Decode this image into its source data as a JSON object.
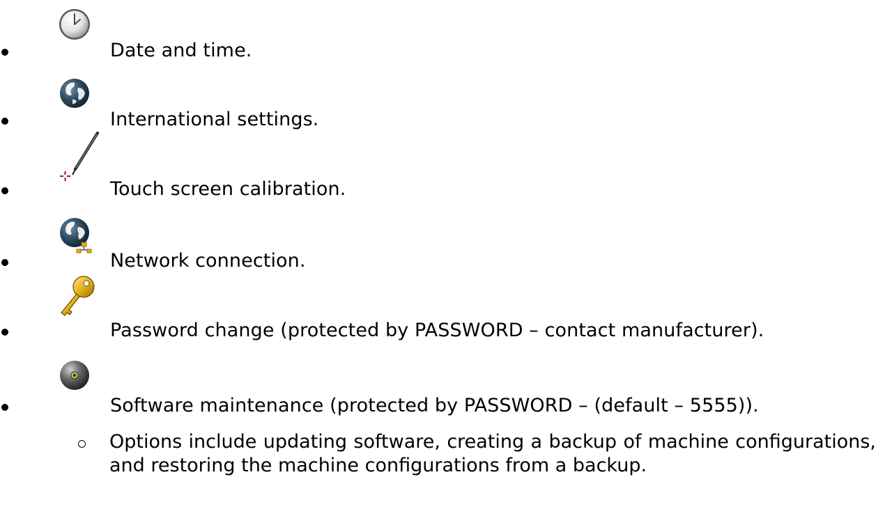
{
  "items": [
    {
      "icon": "clock-icon",
      "label": "Date and time."
    },
    {
      "icon": "globe-icon",
      "label": "International settings."
    },
    {
      "icon": "stylus-icon",
      "label": "Touch screen calibration."
    },
    {
      "icon": "network-globe-icon",
      "label": "Network connection."
    },
    {
      "icon": "key-icon",
      "label": "Password change (protected by PASSWORD – contact manufacturer)."
    },
    {
      "icon": "disc-icon",
      "label": "Software maintenance (protected by PASSWORD – (default – 5555))."
    }
  ],
  "sub_items": [
    {
      "label": "Options include updating software, creating a backup of machine configurations, and restoring the machine configurations from a backup."
    }
  ]
}
